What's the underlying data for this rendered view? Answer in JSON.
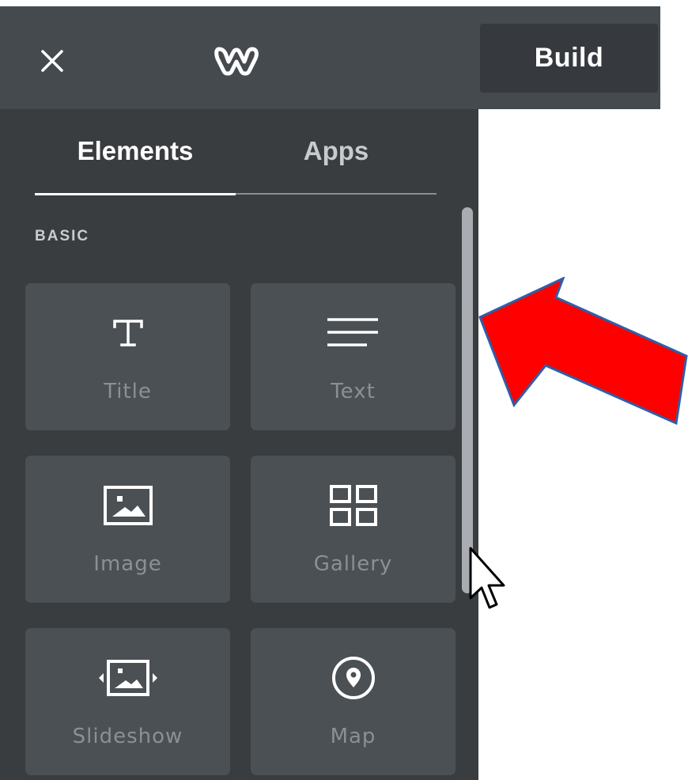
{
  "topbar": {
    "close_icon": "close-icon",
    "logo_icon": "weebly-w-logo",
    "build_label": "Build"
  },
  "sidebar": {
    "tabs": [
      {
        "label": "Elements",
        "active": true
      },
      {
        "label": "Apps",
        "active": false
      }
    ],
    "section_label": "BASIC",
    "items": [
      {
        "label": "Title",
        "icon": "title-icon"
      },
      {
        "label": "Text",
        "icon": "text-lines-icon"
      },
      {
        "label": "Image",
        "icon": "image-icon"
      },
      {
        "label": "Gallery",
        "icon": "gallery-grid-icon"
      },
      {
        "label": "Slideshow",
        "icon": "slideshow-icon"
      },
      {
        "label": "Map",
        "icon": "map-pin-icon"
      }
    ]
  },
  "annotation": {
    "arrow_icon": "red-arrow-icon",
    "arrow_color": "#ff0000",
    "cursor_icon": "mouse-pointer-icon"
  },
  "colors": {
    "topbar": "#454a4f",
    "sidebar": "#393d40",
    "tile": "#4b5055",
    "build_button": "#363a3e"
  }
}
